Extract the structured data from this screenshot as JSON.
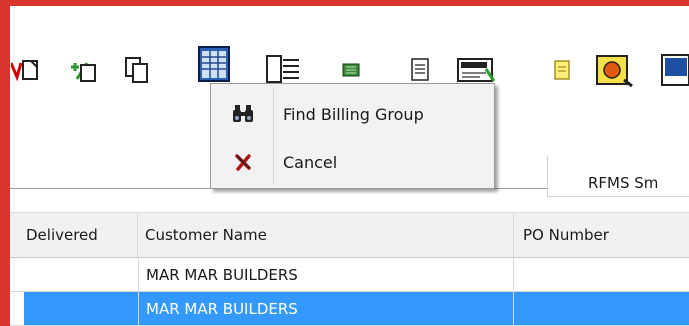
{
  "toolbar": {
    "buttons": [
      {
        "name": "new-document-red-icon"
      },
      {
        "name": "add-remove-icon"
      },
      {
        "name": "copy-document-icon"
      },
      {
        "name": "window-grid-icon"
      },
      {
        "name": "document-list-icon"
      },
      {
        "name": "green-chip-icon"
      },
      {
        "name": "text-document-icon"
      },
      {
        "name": "credit-card-icon"
      },
      {
        "name": "yellow-note-icon"
      },
      {
        "name": "safe-icon"
      },
      {
        "name": "blue-screen-icon"
      }
    ]
  },
  "context_menu": {
    "items": [
      {
        "icon": "binoculars-icon",
        "label": "Find Billing Group"
      },
      {
        "icon": "red-x-icon",
        "label": "Cancel"
      }
    ]
  },
  "search": {
    "value": "",
    "company_label": "RFMS Sm"
  },
  "grid": {
    "columns": [
      "Delivered",
      "Customer Name",
      "PO Number"
    ],
    "rows": [
      {
        "delivered": "",
        "customer": "MAR MAR BUILDERS",
        "po": "",
        "selected": false
      },
      {
        "delivered": "",
        "customer": "MAR MAR BUILDERS",
        "po": "",
        "selected": true
      }
    ]
  },
  "colors": {
    "desktop_red": "#d9352f",
    "selection": "#3399ff",
    "menu_bg": "#f2f2f2"
  }
}
